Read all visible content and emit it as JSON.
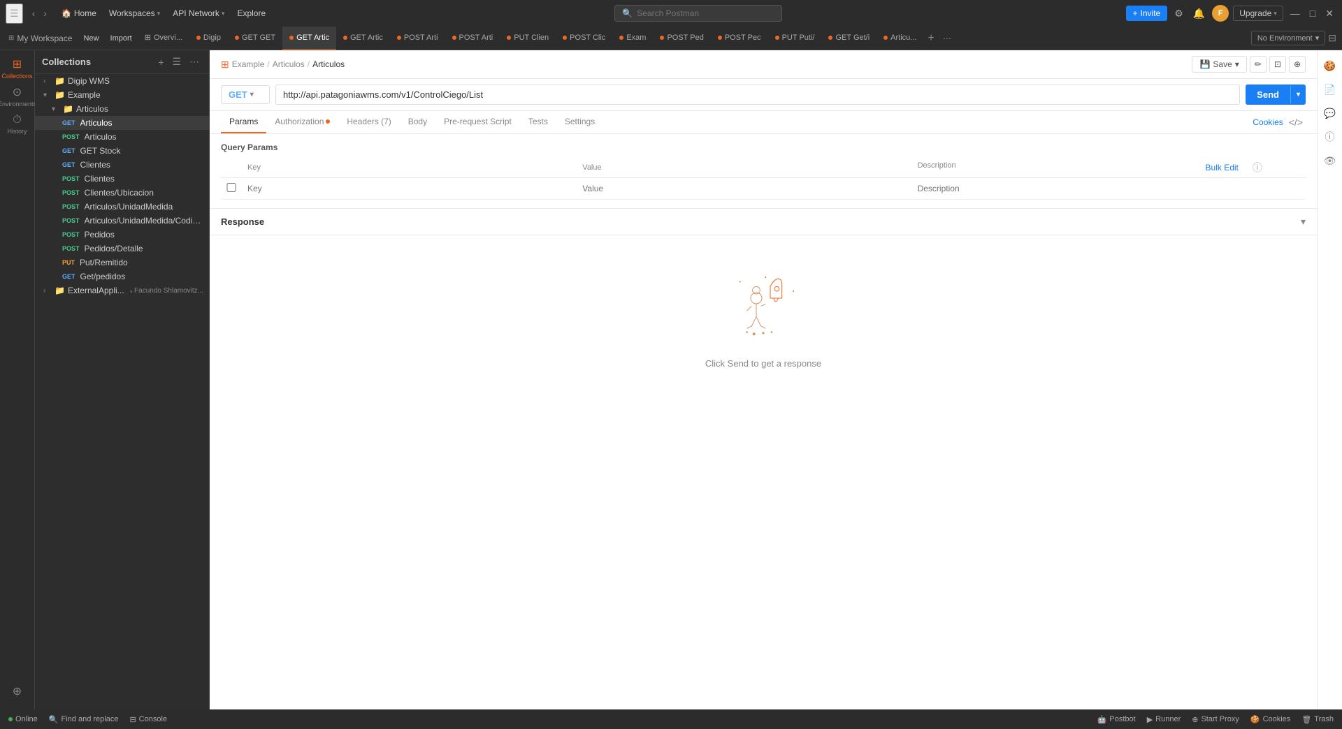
{
  "topbar": {
    "menu_icon": "☰",
    "nav_back": "‹",
    "nav_forward": "›",
    "nav_home": "Home",
    "nav_workspaces": "Workspaces",
    "nav_api_network": "API Network",
    "nav_explore": "Explore",
    "search_placeholder": "Search Postman",
    "invite_label": "Invite",
    "upgrade_label": "Upgrade"
  },
  "tabs": [
    {
      "id": "overview",
      "label": "Overvi...",
      "dot": "none",
      "active": false
    },
    {
      "id": "digip",
      "label": "Digip",
      "dot": "orange",
      "active": false
    },
    {
      "id": "get-get",
      "label": "GET GET",
      "dot": "orange",
      "active": false
    },
    {
      "id": "get-artic1",
      "label": "GET Artic",
      "dot": "orange",
      "active": true
    },
    {
      "id": "get-artic2",
      "label": "GET Artic",
      "dot": "orange",
      "active": false
    },
    {
      "id": "post-arti1",
      "label": "POST Arti",
      "dot": "orange",
      "active": false
    },
    {
      "id": "post-arti2",
      "label": "POST Arti",
      "dot": "orange",
      "active": false
    },
    {
      "id": "put-clien",
      "label": "PUT Clien",
      "dot": "orange",
      "active": false
    },
    {
      "id": "post-clic",
      "label": "POST Clic",
      "dot": "orange",
      "active": false
    },
    {
      "id": "exam",
      "label": "Exam",
      "dot": "orange",
      "active": false
    },
    {
      "id": "post-ped1",
      "label": "POST Ped",
      "dot": "orange",
      "active": false
    },
    {
      "id": "post-ped2",
      "label": "POST Pec",
      "dot": "orange",
      "active": false
    },
    {
      "id": "put-puti",
      "label": "PUT Puti/",
      "dot": "orange",
      "active": false
    },
    {
      "id": "get-geth",
      "label": "GET Get/i",
      "dot": "orange",
      "active": false
    },
    {
      "id": "articu",
      "label": "Articu...",
      "dot": "orange",
      "active": false
    }
  ],
  "env_selector": "No Environment",
  "workspace": {
    "label": "My Workspace",
    "new_btn": "New",
    "import_btn": "Import"
  },
  "sidebar_icons": [
    {
      "id": "collections",
      "icon": "⊞",
      "label": "Collections",
      "active": true
    },
    {
      "id": "environments",
      "icon": "⊙",
      "label": "Environments",
      "active": false
    },
    {
      "id": "history",
      "icon": "⏱",
      "label": "History",
      "active": false
    },
    {
      "id": "plugins",
      "icon": "⊕",
      "label": "",
      "active": false
    }
  ],
  "sidebar": {
    "header": "Collections",
    "tree": [
      {
        "id": "digip-wms",
        "level": 0,
        "type": "folder",
        "label": "Digip WMS",
        "expanded": false,
        "indent": 1
      },
      {
        "id": "example",
        "level": 0,
        "type": "folder",
        "label": "Example",
        "expanded": true,
        "indent": 1
      },
      {
        "id": "articulos-folder",
        "level": 1,
        "type": "folder",
        "label": "Articulos",
        "expanded": true,
        "indent": 2
      },
      {
        "id": "get-articulos",
        "level": 2,
        "type": "request",
        "method": "GET",
        "label": "Articulos",
        "active": true,
        "indent": 3
      },
      {
        "id": "post-articulos",
        "level": 2,
        "type": "request",
        "method": "POST",
        "label": "Articulos",
        "active": false,
        "indent": 3
      },
      {
        "id": "get-stock",
        "level": 2,
        "type": "request",
        "method": "GET",
        "label": "GET Stock",
        "active": false,
        "indent": 3
      },
      {
        "id": "get-clientes",
        "level": 2,
        "type": "request",
        "method": "GET",
        "label": "Clientes",
        "active": false,
        "indent": 3
      },
      {
        "id": "post-clientes",
        "level": 2,
        "type": "request",
        "method": "POST",
        "label": "Clientes",
        "active": false,
        "indent": 3
      },
      {
        "id": "post-clientes-ubicacion",
        "level": 2,
        "type": "request",
        "method": "POST",
        "label": "Clientes/Ubicacion",
        "active": false,
        "indent": 3
      },
      {
        "id": "post-articulos-unidad",
        "level": 2,
        "type": "request",
        "method": "POST",
        "label": "Articulos/UnidadMedida",
        "active": false,
        "indent": 3
      },
      {
        "id": "post-articulos-cod",
        "level": 2,
        "type": "request",
        "method": "POST",
        "label": "Articulos/UnidadMedida/Codig...",
        "active": false,
        "indent": 3
      },
      {
        "id": "post-pedidos",
        "level": 2,
        "type": "request",
        "method": "POST",
        "label": "Pedidos",
        "active": false,
        "indent": 3
      },
      {
        "id": "post-pedidos-detalle",
        "level": 2,
        "type": "request",
        "method": "POST",
        "label": "Pedidos/Detalle",
        "active": false,
        "indent": 3
      },
      {
        "id": "put-remitido",
        "level": 2,
        "type": "request",
        "method": "PUT",
        "label": "Put/Remitido",
        "active": false,
        "indent": 3
      },
      {
        "id": "get-pedidos",
        "level": 2,
        "type": "request",
        "method": "GET",
        "label": "Get/pedidos",
        "active": false,
        "indent": 3
      },
      {
        "id": "external",
        "level": 0,
        "type": "folder",
        "label": "ExternalAppli...",
        "expanded": false,
        "indent": 1,
        "user": "Facundo Shlamovitz..."
      }
    ]
  },
  "request": {
    "method": "GET",
    "url": "http://api.patagoniawms.com/v1/ControlCiego/List",
    "send_label": "Send",
    "tabs": [
      {
        "id": "params",
        "label": "Params",
        "active": true,
        "dot": false
      },
      {
        "id": "authorization",
        "label": "Authorization",
        "active": false,
        "dot": true
      },
      {
        "id": "headers",
        "label": "Headers (7)",
        "active": false,
        "dot": false
      },
      {
        "id": "body",
        "label": "Body",
        "active": false,
        "dot": false
      },
      {
        "id": "pre-request",
        "label": "Pre-request Script",
        "active": false,
        "dot": false
      },
      {
        "id": "tests",
        "label": "Tests",
        "active": false,
        "dot": false
      },
      {
        "id": "settings",
        "label": "Settings",
        "active": false,
        "dot": false
      }
    ],
    "cookies_label": "Cookies",
    "code_icon": "</>",
    "params_title": "Query Params",
    "params_columns": [
      "Key",
      "Value",
      "Description"
    ],
    "params_placeholder_key": "Key",
    "params_placeholder_value": "Value",
    "params_placeholder_desc": "Description",
    "bulk_edit_label": "Bulk Edit"
  },
  "breadcrumb": {
    "icon": "⊞",
    "items": [
      "Example",
      "Articulos",
      "Articulos"
    ],
    "save_label": "Save"
  },
  "response": {
    "title": "Response",
    "empty_message": "Click Send to get a response"
  },
  "bottom_bar": {
    "status": "Online",
    "find_replace": "Find and replace",
    "console": "Console",
    "postbot": "Postbot",
    "runner": "Runner",
    "start_proxy": "Start Proxy",
    "cookies": "Cookies",
    "trash": "Trash"
  }
}
